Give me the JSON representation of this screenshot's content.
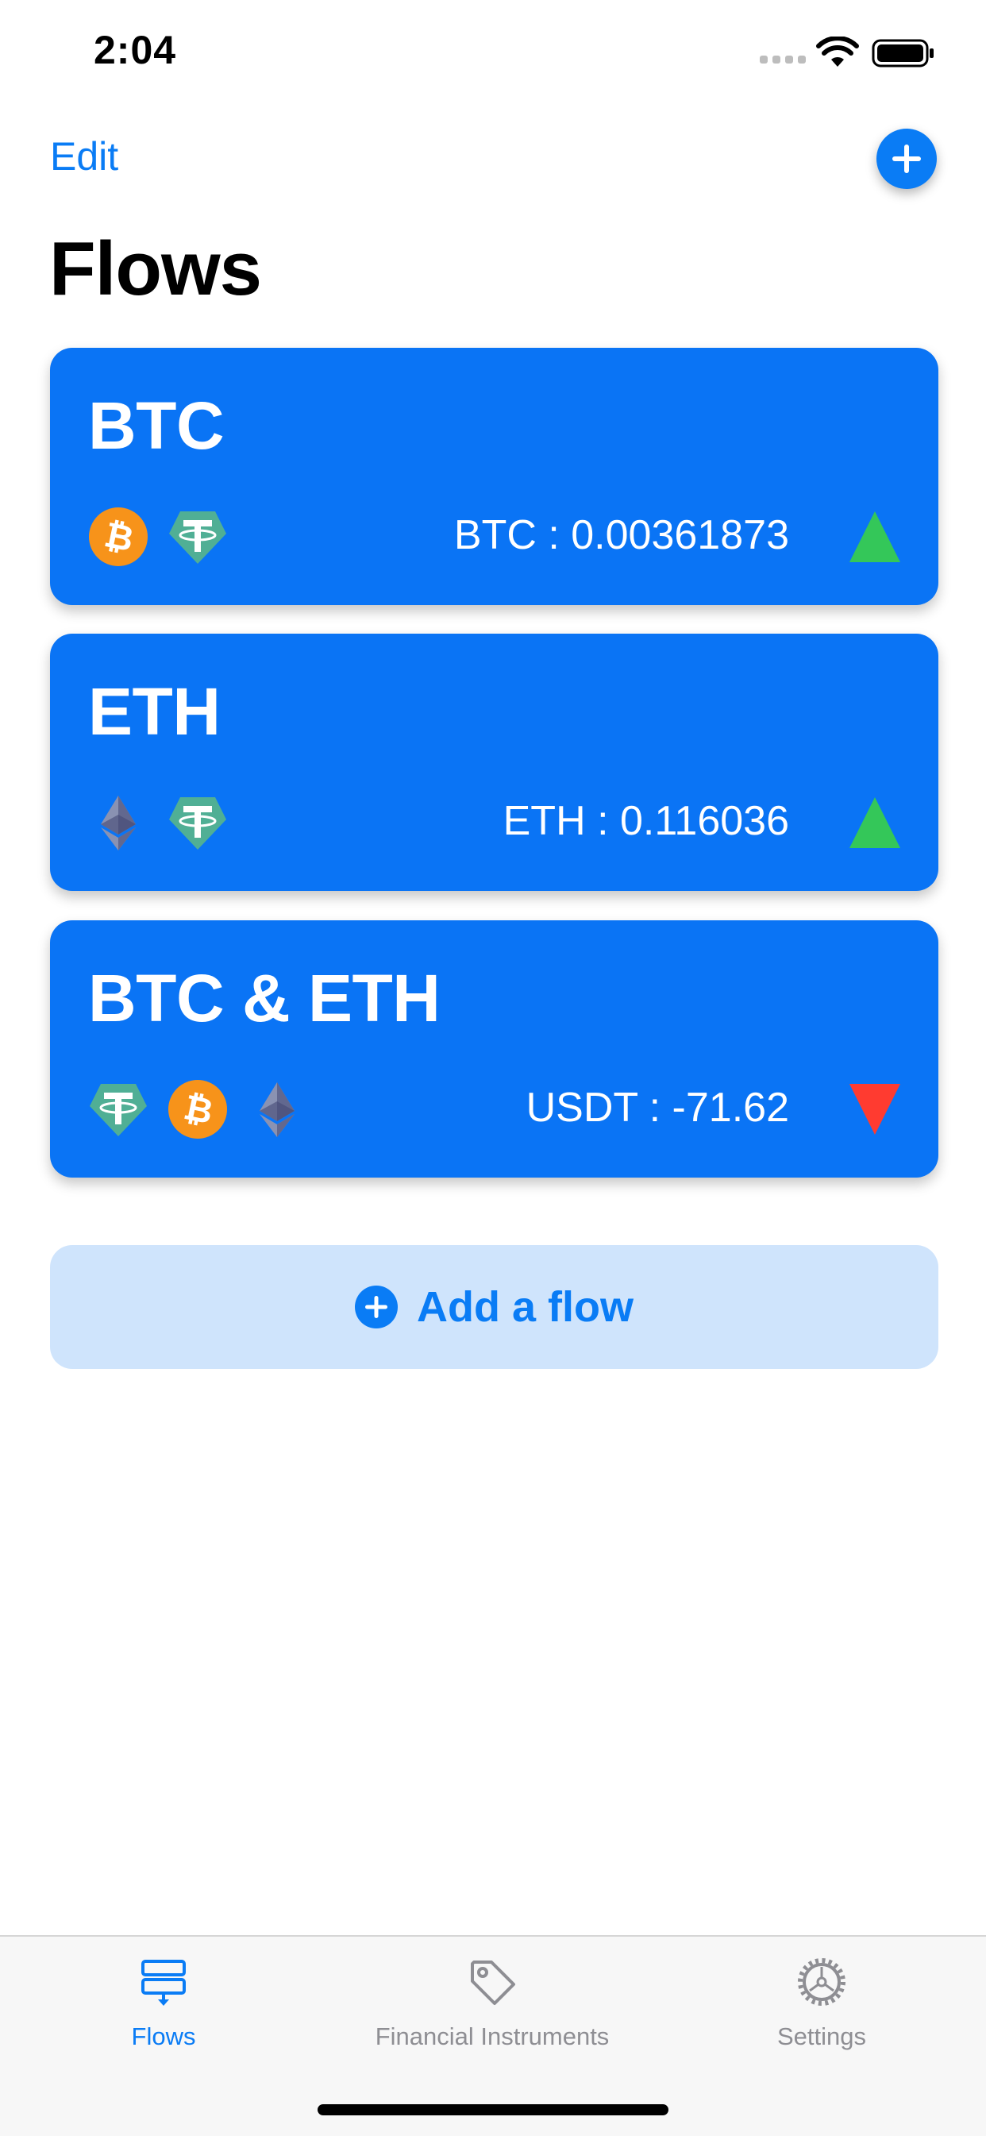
{
  "status_bar": {
    "time": "2:04"
  },
  "nav": {
    "edit_label": "Edit",
    "add_icon": "plus-circle-icon"
  },
  "page_title": "Flows",
  "flows": [
    {
      "name": "BTC",
      "coins": [
        "bitcoin-icon",
        "tether-icon"
      ],
      "balance": "BTC : 0.00361873",
      "trend": "up"
    },
    {
      "name": "ETH",
      "coins": [
        "ethereum-icon",
        "tether-icon"
      ],
      "balance": "ETH : 0.116036",
      "trend": "up"
    },
    {
      "name": "BTC & ETH",
      "coins": [
        "tether-icon",
        "bitcoin-icon",
        "ethereum-icon"
      ],
      "balance": "USDT : -71.62",
      "trend": "down"
    }
  ],
  "add_flow": {
    "label": "Add a flow"
  },
  "tab_bar": {
    "tabs": [
      {
        "label": "Flows",
        "icon": "flows-icon",
        "active": true
      },
      {
        "label": "Financial Instruments",
        "icon": "tag-icon",
        "active": false
      },
      {
        "label": "Settings",
        "icon": "gear-icon",
        "active": false
      }
    ]
  },
  "colors": {
    "accent": "#0a7cf5",
    "card": "#0a74f5",
    "add_flow_bg": "#cfe4fc",
    "trend_up": "#34c759",
    "trend_down": "#ff3b30",
    "bitcoin": "#f7931a",
    "tether": "#50af95",
    "ethereum": "#627eea"
  }
}
